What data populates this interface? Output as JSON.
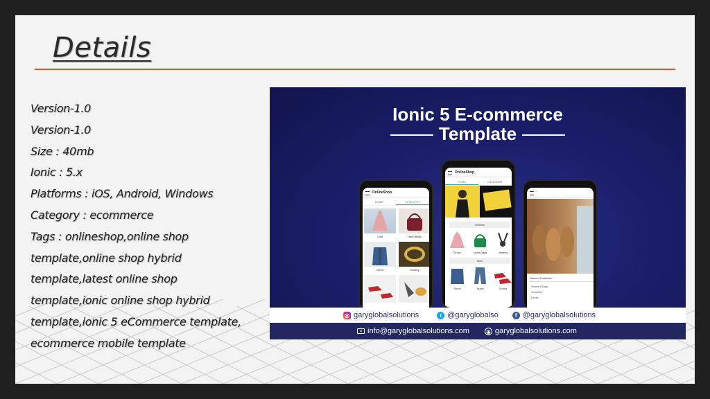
{
  "slide": {
    "title": "Details",
    "lines": [
      "Version-1.0",
      "Version-1.0",
      "Size : 40mb",
      "Ionic : 5.x",
      "Platforms : iOS, Android, Windows",
      "Category : ecommerce",
      "Tags : onlineshop,online shop",
      "template,online shop hybrid",
      "template,latest online shop",
      "template,ionic online shop hybrid",
      "template,ionic 5 eCommerce template,",
      "ecommerce mobile template"
    ]
  },
  "promo": {
    "title_line1": "Ionic 5 E-commerce",
    "title_line2": "Template",
    "app_name": "OnlineShop",
    "tab_home": "HOME",
    "tab_category": "CATEGORY",
    "section_women": "Women",
    "section_men": "Men",
    "left_tiles": [
      "Girls",
      "Hand Bags",
      "Mens",
      "Jewelry"
    ],
    "middle_tiles": [
      "Dress",
      "Hand Bags",
      "Jewelry",
      "Shirts",
      "Jeans",
      "Shoes"
    ],
    "right_collection": "Women Collection",
    "right_items": [
      "Women Bags",
      "Jewellery",
      "Dress"
    ],
    "social": {
      "instagram": "garyglobalsolutions",
      "twitter": "@garyglobalso",
      "facebook": "@garyglobalsolutions"
    },
    "contact": {
      "email": "info@garyglobalsolutions.com",
      "website": "garyglobalsolutions.com"
    }
  },
  "colors": {
    "accent_rule": "#d85a32",
    "promo_bg": "#1b1f6b",
    "contact_bar": "#22285f"
  }
}
